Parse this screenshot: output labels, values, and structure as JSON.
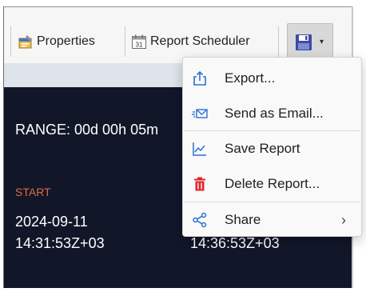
{
  "toolbar": {
    "properties_label": "Properties",
    "report_scheduler_label": "Report Scheduler",
    "save_icon": "floppy-disk-icon",
    "dropdown_icon": "chevron-down-icon",
    "properties_icon": "properties-icon",
    "scheduler_icon": "calendar-icon",
    "calendar_day": "31"
  },
  "panel": {
    "range_text": "RANGE: 00d 00h 05m",
    "start_label": "START",
    "start_date": "2024-09-11",
    "start_time": "14:31:53Z+03",
    "end_time": "14:36:53Z+03",
    "start_label_color": "#e06b45",
    "background_color": "#111629"
  },
  "menu": {
    "items": [
      {
        "label": "Export...",
        "icon": "export-icon"
      },
      {
        "label": "Send as Email...",
        "icon": "email-icon"
      },
      {
        "label": "Save Report",
        "icon": "chart-save-icon"
      },
      {
        "label": "Delete Report...",
        "icon": "trash-icon"
      },
      {
        "label": "Share",
        "icon": "share-icon",
        "submenu": true
      }
    ],
    "icon_color": "#2f6fd6",
    "delete_icon_color": "#e0262c"
  }
}
